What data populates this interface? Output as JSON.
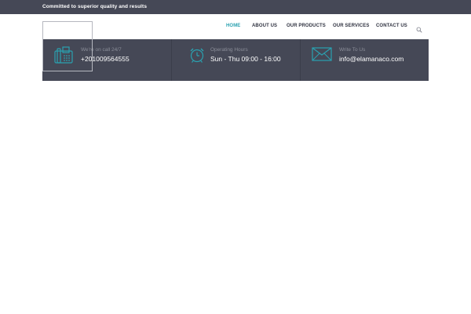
{
  "topbar": {
    "tagline": "Committed to superior quality and results"
  },
  "nav": {
    "items": [
      {
        "label": "HOME",
        "active": true
      },
      {
        "label": "ABOUT US",
        "active": false
      },
      {
        "label": "OUR PRODUCTS",
        "active": false
      },
      {
        "label": "OUR SERVICES",
        "active": false
      },
      {
        "label": "CONTACT US",
        "active": false
      }
    ],
    "search_icon": "search-icon"
  },
  "info": [
    {
      "icon": "phone-icon",
      "label": "We're on call 24/7",
      "value": "+201009564555"
    },
    {
      "icon": "alarm-clock-icon",
      "label": "Operating Hours",
      "value": "Sun - Thu 09:00 - 16:00"
    },
    {
      "icon": "envelope-icon",
      "label": "Write To Us",
      "value": "info@elamanaco.com"
    }
  ],
  "colors": {
    "bar_bg": "#454856",
    "accent": "#2aa1b0",
    "nav_text": "#2f3240"
  }
}
